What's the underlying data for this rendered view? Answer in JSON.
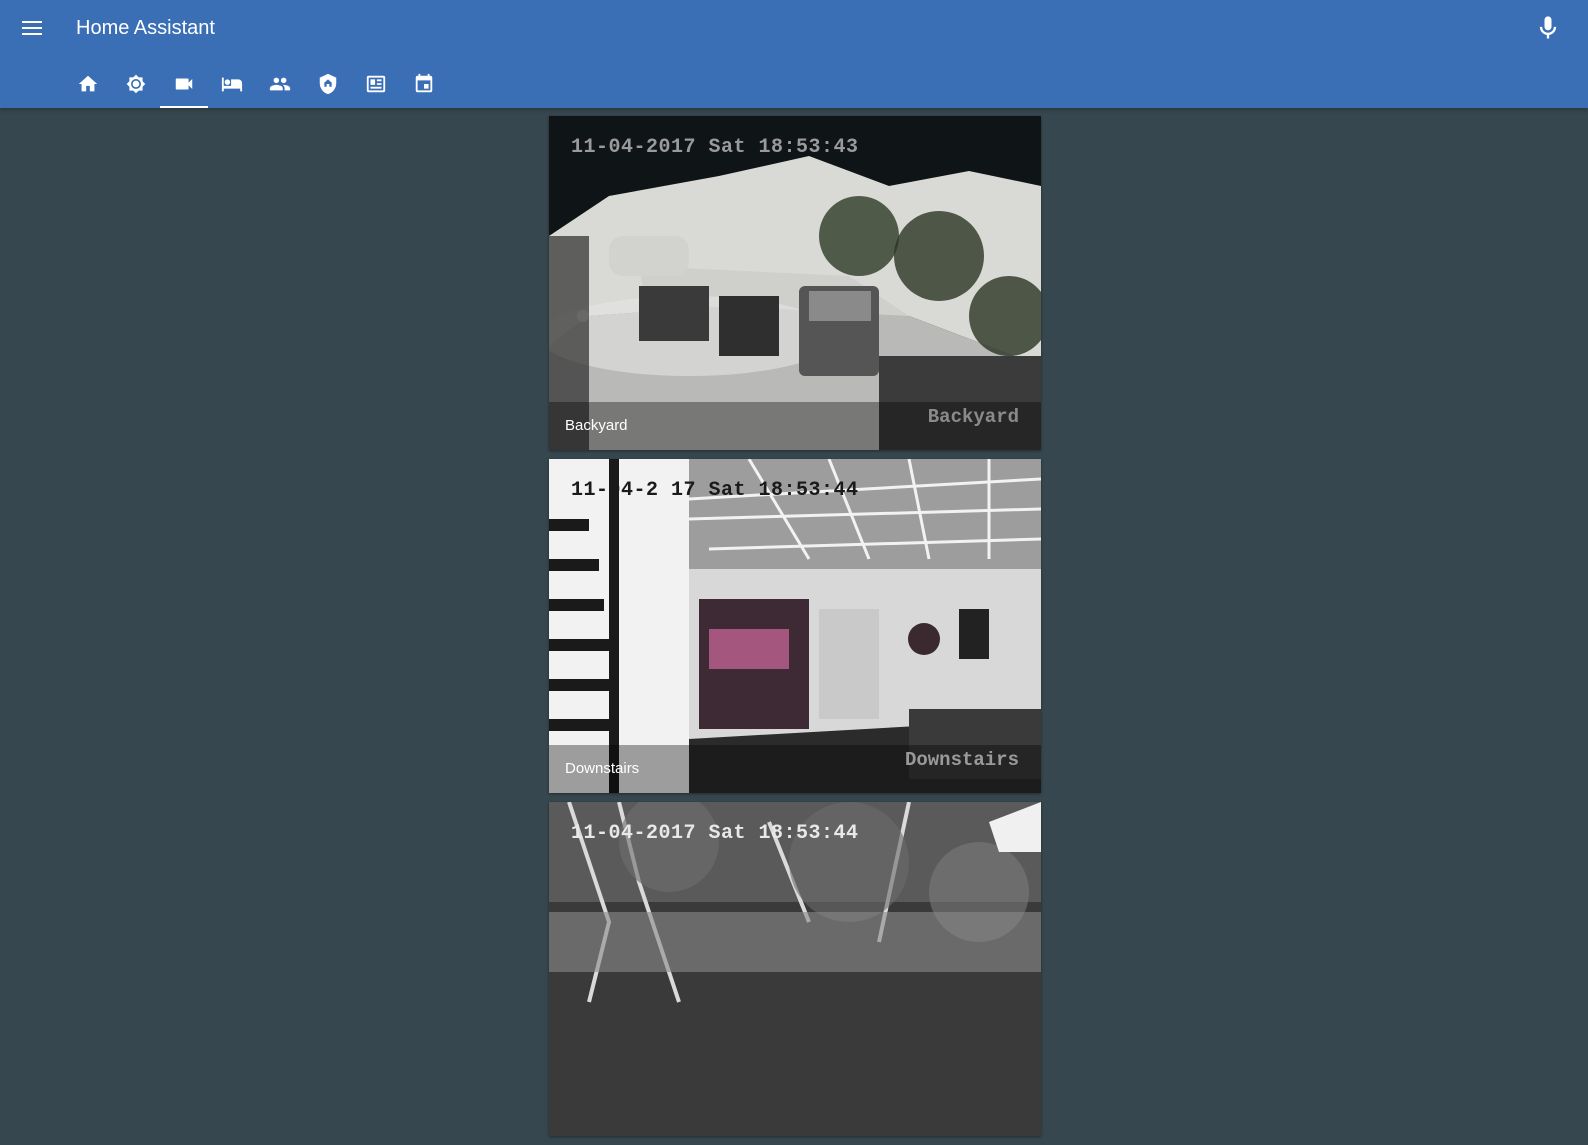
{
  "app": {
    "title": "Home Assistant"
  },
  "header": {
    "menu_icon": "menu-icon",
    "mic_icon": "microphone-icon"
  },
  "tabs": [
    {
      "icon": "home-icon",
      "active": false
    },
    {
      "icon": "brightness-icon",
      "active": false
    },
    {
      "icon": "video-camera-icon",
      "active": true
    },
    {
      "icon": "bed-icon",
      "active": false
    },
    {
      "icon": "people-icon",
      "active": false
    },
    {
      "icon": "security-shield-icon",
      "active": false
    },
    {
      "icon": "newspaper-icon",
      "active": false
    },
    {
      "icon": "calendar-icon",
      "active": false
    }
  ],
  "cameras": [
    {
      "name": "Backyard",
      "timestamp": "11-04-2017 Sat 18:53:43",
      "osd_label": "Backyard"
    },
    {
      "name": "Downstairs",
      "timestamp": "11-04-2 17 Sat 18:53:44",
      "osd_label": "Downstairs"
    },
    {
      "name": "",
      "timestamp": "11-04-2017 Sat 18:53:44",
      "osd_label": ""
    }
  ],
  "colors": {
    "header": "#3a6fb6",
    "background": "#37474f",
    "text": "#ffffff"
  }
}
